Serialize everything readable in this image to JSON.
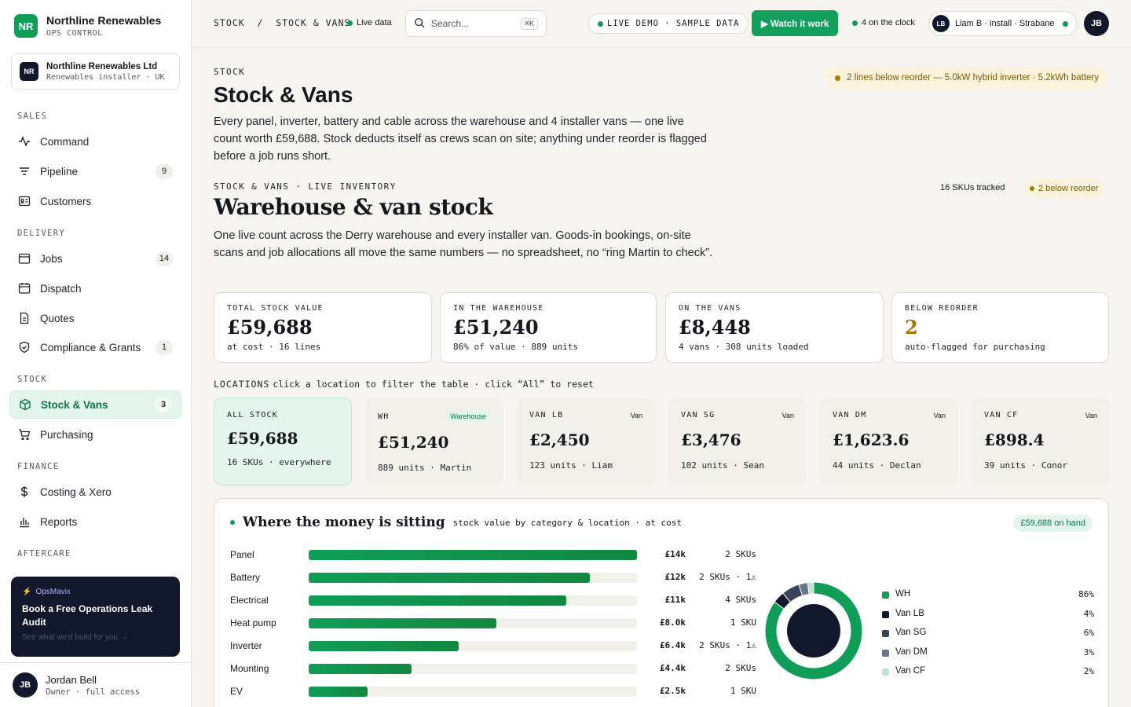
{
  "brand": {
    "initials": "NR",
    "name": "Northline Renewables",
    "sub": "OPS CONTROL"
  },
  "org": {
    "initials": "NR",
    "name": "Northline Renewables Ltd",
    "sub": "Renewables installer · UK"
  },
  "nav": {
    "sales": "SALES",
    "delivery": "DELIVERY",
    "stock": "STOCK",
    "finance": "FINANCE",
    "aftercare": "AFTERCARE",
    "items": {
      "command": {
        "label": "Command"
      },
      "pipeline": {
        "label": "Pipeline",
        "badge": "9"
      },
      "customers": {
        "label": "Customers"
      },
      "jobs": {
        "label": "Jobs",
        "badge": "14"
      },
      "dispatch": {
        "label": "Dispatch"
      },
      "quotes": {
        "label": "Quotes"
      },
      "compliance": {
        "label": "Compliance & Grants",
        "badge": "1"
      },
      "stockvans": {
        "label": "Stock & Vans",
        "badge": "3"
      },
      "purchasing": {
        "label": "Purchasing"
      },
      "costing": {
        "label": "Costing & Xero"
      },
      "reports": {
        "label": "Reports"
      }
    }
  },
  "promo": {
    "brand": "OpsMavix",
    "title": "Book a Free Operations Leak Audit",
    "sub": "See what we'd build for you →"
  },
  "user": {
    "initials": "JB",
    "name": "Jordan Bell",
    "sub": "Owner · full access"
  },
  "topbar": {
    "crumb": "STOCK  /  STOCK & VANS",
    "live": "Live data",
    "search_placeholder": "Search...",
    "kbd": "⌘K",
    "demo": "LIVE DEMO · SAMPLE DATA",
    "watch": "▶ Watch it work",
    "on_clock": "4 on the clock",
    "person": {
      "initials": "LB",
      "label": "Liam B · install · Strabane"
    },
    "avatar": "JB"
  },
  "header": {
    "eyebrow": "STOCK",
    "title": "Stock & Vans",
    "lead": "Every panel, inverter, battery and cable across the warehouse and 4 installer vans — one live count worth £59,688. Stock deducts itself as crews scan on site; anything under reorder is flagged before a job runs short.",
    "warn": "2 lines below reorder — 5.0kW hybrid inverter · 5.2kWh battery"
  },
  "inventory": {
    "eyebrow": "STOCK & VANS · LIVE INVENTORY",
    "title": "Warehouse & van stock",
    "lead": "One live count across the Derry warehouse and every installer van. Goods-in bookings, on-site scans and job allocations all move the same numbers — no spreadsheet, no “ring Martin to check”.",
    "skus": "16 SKUs tracked",
    "below": "2 below reorder"
  },
  "kpis": [
    {
      "label": "TOTAL STOCK VALUE",
      "value": "£59,688",
      "sub": "at cost · 16 lines"
    },
    {
      "label": "IN THE WAREHOUSE",
      "value": "£51,240",
      "sub": "86% of value · 889 units"
    },
    {
      "label": "ON THE VANS",
      "value": "£8,448",
      "sub": "4 vans · 308 units loaded"
    },
    {
      "label": "BELOW REORDER",
      "value": "2",
      "sub": "auto-flagged for purchasing"
    }
  ],
  "locations": {
    "label": "LOCATIONS",
    "hint": "click a location to filter the table · click “All” to reset",
    "items": [
      {
        "code": "ALL STOCK",
        "tag": "",
        "value": "£59,688",
        "sub": "16 SKUs · everywhere"
      },
      {
        "code": "WH",
        "tag": "Warehouse",
        "value": "£51,240",
        "sub": "889 units · Martin"
      },
      {
        "code": "VAN LB",
        "tag": "Van",
        "value": "£2,450",
        "sub": "123 units · Liam"
      },
      {
        "code": "VAN SG",
        "tag": "Van",
        "value": "£3,476",
        "sub": "102 units · Sean"
      },
      {
        "code": "VAN DM",
        "tag": "Van",
        "value": "£1,623.6",
        "sub": "44 units · Declan"
      },
      {
        "code": "VAN CF",
        "tag": "Van",
        "value": "£898.4",
        "sub": "39 units · Conor"
      }
    ]
  },
  "money": {
    "title": "Where the money is sitting",
    "sub": "stock value by category & location · at cost",
    "on_hand": "£59,688 on hand"
  },
  "chart_data": [
    {
      "type": "bar",
      "orientation": "horizontal",
      "categories": [
        "Panel",
        "Battery",
        "Electrical",
        "Heat pump",
        "Inverter",
        "Mounting",
        "EV"
      ],
      "values": [
        14000,
        12000,
        11000,
        8000,
        6400,
        4400,
        2500
      ],
      "value_labels": [
        "£14k",
        "£12k",
        "£11k",
        "£8.0k",
        "£6.4k",
        "£4.4k",
        "£2.5k"
      ],
      "sku_labels": [
        "2 SKUs",
        "2 SKUs · 1⚠",
        "4 SKUs",
        "1 SKU",
        "2 SKUs · 1⚠",
        "2 SKUs",
        "1 SKU"
      ],
      "xlim": [
        0,
        14000
      ]
    },
    {
      "type": "pie",
      "style": "donut",
      "labels": [
        "WH",
        "Van LB",
        "Van SG",
        "Van DM",
        "Van CF"
      ],
      "values": [
        86,
        4,
        6,
        3,
        2
      ],
      "pct_labels": [
        "86%",
        "4%",
        "6%",
        "3%",
        "2%"
      ],
      "colors": [
        "#0f9d58",
        "#12182b",
        "#3a4459",
        "#6b7589",
        "#b9e6cf"
      ]
    }
  ]
}
